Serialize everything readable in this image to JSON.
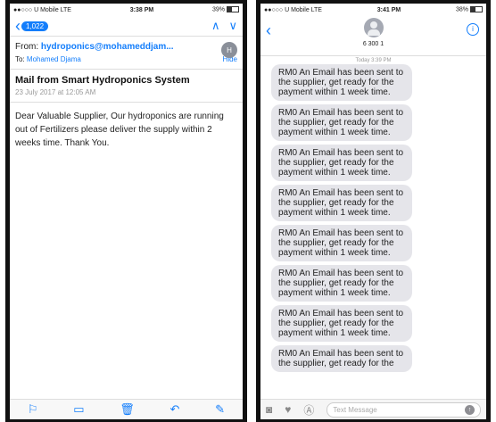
{
  "mail_phone": {
    "status": {
      "carrier": "●●○○○ U Mobile LTE",
      "time": "3:38 PM",
      "battery": "39%"
    },
    "nav": {
      "back_count": "1,022",
      "up": "∧",
      "down": "∨"
    },
    "from_label": "From:",
    "from_address": "hydroponics@mohameddjam...",
    "to_label": "To:",
    "to_name": "Mohamed Djama",
    "hide_label": "Hide",
    "avatar_initial": "H",
    "subject": "Mail from Smart Hydroponics System",
    "date": "23 July 2017 at 12:05 AM",
    "body": "Dear Valuable Supplier, Our hydroponics are running out of Fertilizers please deliver the supply within 2 weeks time.  Thank You."
  },
  "msg_phone": {
    "status": {
      "carrier": "●●○○○ U Mobile LTE",
      "time": "3:41 PM",
      "battery": "38%"
    },
    "contact_number": "6 300 1",
    "conversation_time": "Today 3:39 PM",
    "messages": [
      "RM0 An Email has been sent to the supplier, get ready for the payment within 1 week time.",
      "RM0 An Email has been sent to the supplier, get ready for the payment within 1 week time.",
      "RM0 An Email has been sent to the supplier, get ready for the payment within 1 week time.",
      "RM0 An Email has been sent to the supplier, get ready for the payment within 1 week time.",
      "RM0 An Email has been sent to the supplier, get ready for the payment within 1 week time.",
      "RM0 An Email has been sent to the supplier, get ready for the payment within 1 week time.",
      "RM0 An Email has been sent to the supplier, get ready for the payment within 1 week time.",
      "RM0 An Email has been sent to the supplier, get ready for the"
    ],
    "input_placeholder": "Text Message"
  }
}
